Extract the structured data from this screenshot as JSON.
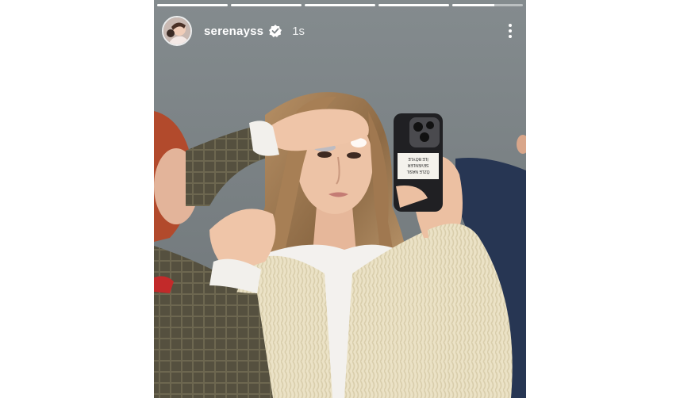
{
  "story": {
    "username": "serenayss",
    "timestamp": "1s",
    "verified": true,
    "progress_segments": [
      1,
      1,
      1,
      1,
      0.6
    ]
  },
  "phone_case_sticker": {
    "lines": [
      "ÖZLE NASIL",
      "SEVENLER",
      "İLE BÖYLE"
    ]
  },
  "icons": {
    "verified": "verified-badge-icon",
    "more": "more-vertical-icon"
  },
  "colors": {
    "background": "#7c8386",
    "sweater": "#e9dfc1",
    "hair": "#9b7650",
    "phone_case": "#202023"
  }
}
